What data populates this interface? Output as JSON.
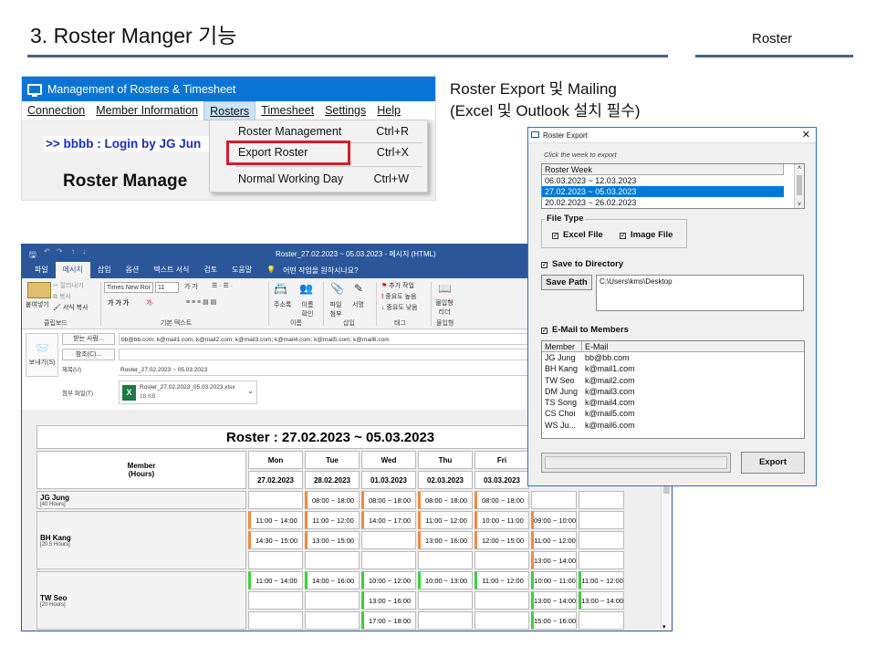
{
  "slide": {
    "title": "3. Roster Manger 기능",
    "section": "Roster",
    "note": "Roster Export  및 Mailing\n(Excel 및 Outlook 설치 필수)"
  },
  "app": {
    "window_title": "Management of Rosters & Timesheet",
    "menu": [
      {
        "label": "Connection"
      },
      {
        "label": "Member Information"
      },
      {
        "label": "Rosters"
      },
      {
        "label": "Timesheet"
      },
      {
        "label": "Settings"
      },
      {
        "label": "Help"
      }
    ],
    "login_text": ">> bbbb : Login by JG Jun",
    "heading": "Roster Manage",
    "dropdown": [
      {
        "label": "Roster Management",
        "shortcut": "Ctrl+R"
      },
      {
        "label": "Export Roster",
        "shortcut": "Ctrl+X"
      },
      {
        "label": "Normal Working Day",
        "shortcut": "Ctrl+W"
      }
    ]
  },
  "outlook": {
    "title": "Roster_27.02.2023 ~ 05.03.2023  -  메시지 (HTML)",
    "tabs": [
      "파일",
      "메시지",
      "삽입",
      "옵션",
      "텍스트 서식",
      "검토",
      "도움말"
    ],
    "tell_me": "어떤 작업을 원하시나요?",
    "ribbon": {
      "paste": "붙여넣기",
      "cut": "잘라내기",
      "copy": "복사",
      "format_painter": "서식 복사",
      "clipboard_group": "클립보드",
      "font_name": "Times New Ror",
      "font_size": "11",
      "basic_text_group": "기본 텍스트",
      "address_book": "주소록",
      "check_names": "이름 확인",
      "names_group": "이름",
      "attach_file": "파일 첨부",
      "signature": "서명",
      "insert_group": "삽입",
      "follow_up": "추가 작업",
      "high_importance": "중요도 높음",
      "low_importance": "중요도 낮음",
      "tags_group": "태그",
      "reader": "몰입형 리더",
      "immersive_group": "몰입형"
    },
    "send": "보내기(S)",
    "to_button": "받는 사람...",
    "cc_button": "참조(C)...",
    "subject_label": "제목(U)",
    "attach_label": "첨부 파일(T)",
    "to_value": "bb@bb.com; k@mail1.com; k@mail2.com; k@mail3.com; k@mail4.com; k@mail5.com; k@mail6.com",
    "subject_value": "Roster_27.02.2023 ~ 05.03.2023",
    "attachment_name": "Roster_27.02.2023_05.03.2023.xlsx",
    "attachment_size": "18 KB",
    "roster_caption": "Roster : 27.02.2023 ~ 05.03.2023",
    "member_header": "Member",
    "hours_header": "(Hours)",
    "days": [
      {
        "day": "Mon",
        "date": "27.02.2023"
      },
      {
        "day": "Tue",
        "date": "28.02.2023"
      },
      {
        "day": "Wed",
        "date": "01.03.2023"
      },
      {
        "day": "Thu",
        "date": "02.03.2023"
      },
      {
        "day": "Fri",
        "date": "03.03.2023"
      },
      {
        "day": "",
        "date": ""
      },
      {
        "day": "",
        "date": ""
      }
    ],
    "rows": [
      {
        "name": "JG Jung",
        "hours": "[40 Hours]",
        "color": "orange",
        "lines": [
          [
            "",
            "08:00 ~ 18:00",
            "08:00 ~ 18:00",
            "08:00 ~ 18:00",
            "08:00 ~ 18:00",
            "",
            ""
          ]
        ]
      },
      {
        "name": "BH Kang",
        "hours": "[20.5 Hours]",
        "color": "orange",
        "lines": [
          [
            "11:00 ~ 14:00",
            "11:00 ~ 12:00",
            "14:00 ~ 17:00",
            "11:00 ~ 12:00",
            "10:00 ~ 11:00",
            "09:00 ~ 10:00",
            ""
          ],
          [
            "14:30 ~ 15:00",
            "13:00 ~ 15:00",
            "",
            "13:00 ~ 16:00",
            "12:00 ~ 15:00",
            "11:00 ~ 12:00",
            ""
          ],
          [
            "",
            "",
            "",
            "",
            "",
            "13:00 ~ 14:00",
            ""
          ]
        ]
      },
      {
        "name": "TW Seo",
        "hours": "[20 Hours]",
        "color": "green",
        "lines": [
          [
            "11:00 ~ 14:00",
            "14:00 ~ 16:00",
            "10:00 ~ 12:00",
            "10:00 ~ 13:00",
            "11:00 ~ 12:00",
            "10:00 ~ 11:00",
            "11:00 ~ 12:00"
          ],
          [
            "",
            "",
            "13:00 ~ 16:00",
            "",
            "",
            "13:00 ~ 14:00",
            "13:00 ~ 14:00"
          ],
          [
            "",
            "",
            "17:00 ~ 18:00",
            "",
            "",
            "15:00 ~ 16:00",
            ""
          ]
        ]
      }
    ]
  },
  "export_dialog": {
    "title": "Roster Export",
    "close": "✕",
    "hint": "Click the week to export",
    "week_header": "Roster Week",
    "weeks": [
      "06.03.2023 ~ 12.03.2023",
      "27.02.2023 ~ 05.03.2023",
      "20.02.2023 ~ 26.02.2023"
    ],
    "selected_week": 1,
    "file_type_label": "File Type",
    "excel_file": "Excel File",
    "image_file": "Image File",
    "save_dir_label": "Save to Directory",
    "save_path_button": "Save Path",
    "save_path_value": "C:\\Users\\kms\\Desktop",
    "email_label": "E-Mail to Members",
    "member_col": "Member",
    "email_col": "E-Mail",
    "members": [
      {
        "name": "JG Jung",
        "email": "bb@bb.com"
      },
      {
        "name": "BH Kang",
        "email": "k@mail1.com"
      },
      {
        "name": "TW Seo",
        "email": "k@mail2.com"
      },
      {
        "name": "DM Jung",
        "email": "k@mail3.com"
      },
      {
        "name": "TS Song",
        "email": "k@mail4.com"
      },
      {
        "name": "CS Choi",
        "email": "k@mail5.com"
      },
      {
        "name": "WS Ju...",
        "email": "k@mail6.com"
      }
    ],
    "export_button": "Export"
  },
  "colors": {
    "title_blue": "#0a74d4",
    "outlook_blue": "#2b579a",
    "highlight_red": "#d0202a",
    "select_blue": "#0078d7",
    "orange_mark": "#f08a40",
    "green_mark": "#3ad23a"
  }
}
